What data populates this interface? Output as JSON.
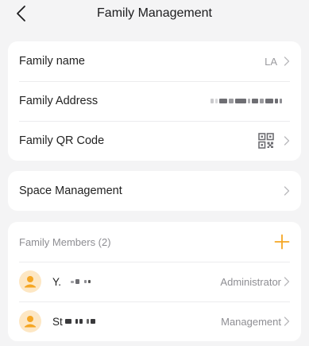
{
  "header": {
    "title": "Family Management"
  },
  "family_info": {
    "name_label": "Family name",
    "name_value": "LA",
    "address_label": "Family Address",
    "qr_label": "Family QR Code"
  },
  "space": {
    "label": "Space Management"
  },
  "members": {
    "title": "Family Members (2)",
    "list": [
      {
        "name": "Y.",
        "role": "Administrator"
      },
      {
        "name": "St",
        "role": "Management"
      }
    ]
  },
  "colors": {
    "accent": "#f5a623",
    "avatar_bg": "#fde7c4",
    "secondary_text": "#9b9b9f",
    "page_bg": "#f4f4f5"
  },
  "icons": {
    "back": "chevron-left-icon",
    "chevron": "chevron-right-icon",
    "qr": "qr-code-icon",
    "add": "plus-icon",
    "avatar": "person-icon"
  }
}
